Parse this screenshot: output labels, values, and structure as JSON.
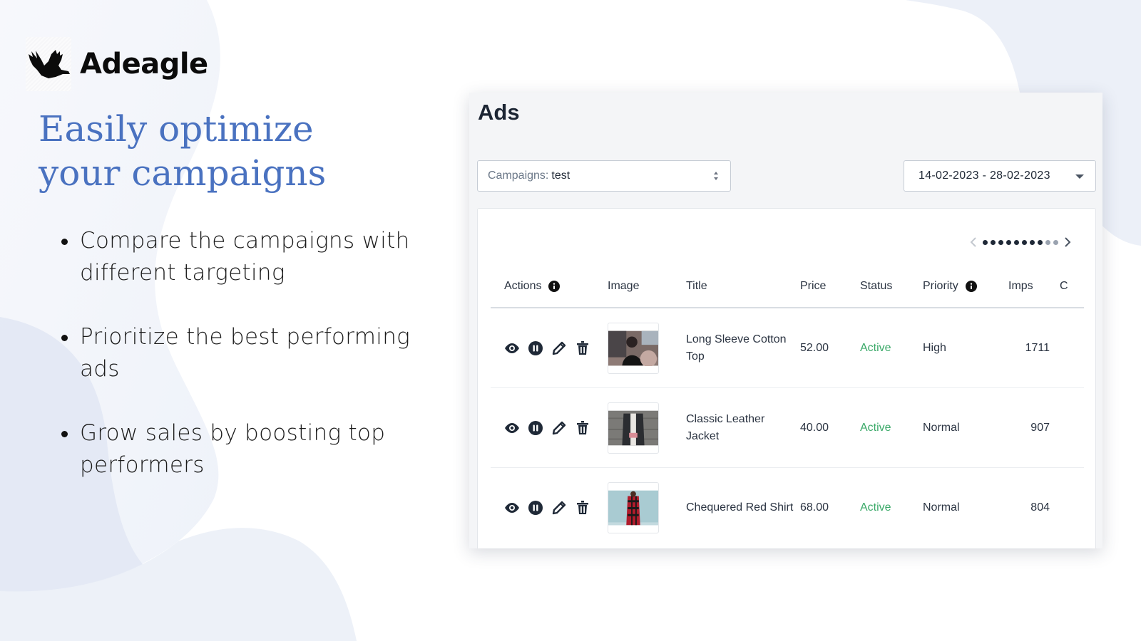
{
  "brand": {
    "name": "Adeagle",
    "logo_icon": "eagle-icon"
  },
  "headline": {
    "line1": "Easily optimize",
    "line2": "your campaigns",
    "color": "#4a72c0"
  },
  "bullets": [
    {
      "text": "Compare the campaigns with different targeting"
    },
    {
      "text": "Prioritize the best performing ads"
    },
    {
      "text": "Grow sales by boosting top performers"
    }
  ],
  "app": {
    "page_title": "Ads",
    "campaign_filter": {
      "label": "Campaigns:",
      "value": "test",
      "icon": "select-updown-icon"
    },
    "date_range": {
      "value": "14-02-2023 - 28-02-2023",
      "icon": "caret-down-icon"
    },
    "pager": {
      "total_dots": 10,
      "active_dots": 8,
      "prev_icon": "chevron-left-icon",
      "next_icon": "chevron-right-icon"
    },
    "table": {
      "columns": [
        "Actions",
        "Image",
        "Title",
        "Price",
        "Status",
        "Priority",
        "Imps",
        "C"
      ],
      "column_info_icons": [
        "Actions",
        "Priority"
      ],
      "row_actions": [
        "view-icon",
        "pause-icon",
        "edit-icon",
        "delete-icon"
      ],
      "rows": [
        {
          "title": "Long Sleeve Cotton Top",
          "price": "52.00",
          "status": "Active",
          "priority": "High",
          "imps": "1711",
          "image": "woman-black-top-photo"
        },
        {
          "title": "Classic Leather Jacket",
          "price": "40.00",
          "status": "Active",
          "priority": "Normal",
          "imps": "907",
          "image": "leather-jacket-photo"
        },
        {
          "title": "Chequered Red Shirt",
          "price": "68.00",
          "status": "Active",
          "priority": "Normal",
          "imps": "804",
          "image": "red-checked-shirt-photo"
        }
      ]
    },
    "colors": {
      "status_active": "#3aa968",
      "panel_bg": "#f4f5f7",
      "text": "#2b3442"
    }
  }
}
